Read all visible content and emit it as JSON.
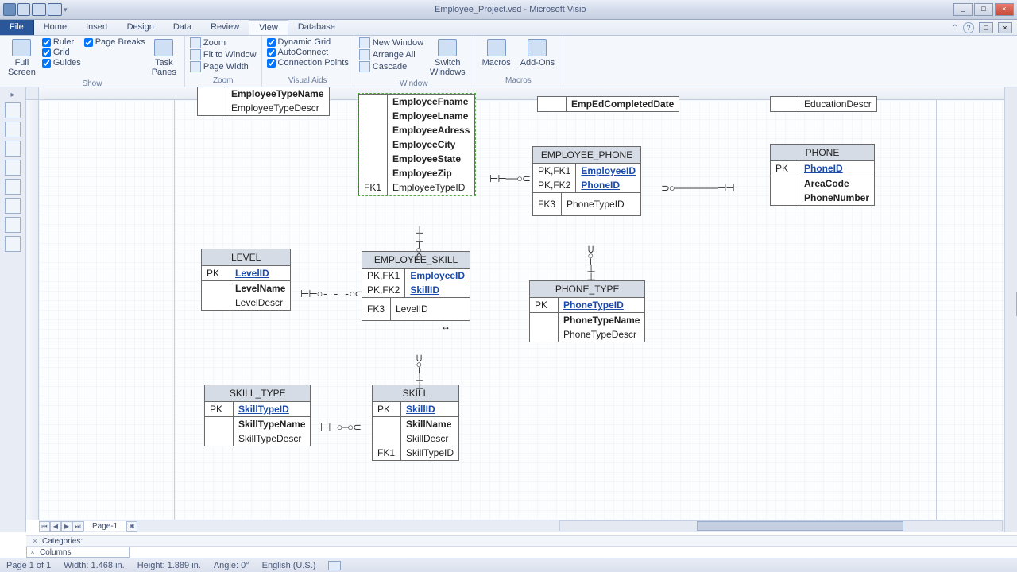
{
  "app": {
    "title": "Employee_Project.vsd - Microsoft Visio"
  },
  "menu": {
    "file": "File",
    "home": "Home",
    "insert": "Insert",
    "design": "Design",
    "data": "Data",
    "review": "Review",
    "view": "View",
    "database": "Database"
  },
  "ribbon": {
    "show": {
      "label": "Show",
      "ruler": "Ruler",
      "grid": "Grid",
      "guides": "Guides",
      "pagebreaks": "Page Breaks",
      "fullscreen": "Full\nScreen",
      "taskpanes": "Task\nPanes"
    },
    "zoom": {
      "label": "Zoom",
      "zoom": "Zoom",
      "fit": "Fit to Window",
      "width": "Page Width"
    },
    "visual": {
      "label": "Visual Aids",
      "dynamic": "Dynamic Grid",
      "auto": "AutoConnect",
      "conn": "Connection Points"
    },
    "window": {
      "label": "Window",
      "neww": "New Window",
      "arrange": "Arrange All",
      "cascade": "Cascade",
      "switch": "Switch\nWindows"
    },
    "macros": {
      "label": "Macros",
      "macros": "Macros",
      "addons": "Add-Ons"
    }
  },
  "entities": {
    "emptype": {
      "rows": [
        "EmployeeTypeName",
        "EmployeeTypeDescr"
      ]
    },
    "employee": {
      "rows": [
        "EmployeeFname",
        "EmployeeLname",
        "EmployeeAdress",
        "EmployeeCity",
        "EmployeeState",
        "EmployeeZip"
      ],
      "fk1": "FK1",
      "fkval": "EmployeeTypeID"
    },
    "emped": {
      "val": "EmpEdCompletedDate"
    },
    "edu": {
      "val": "EducationDescr"
    },
    "empphone": {
      "title": "EMPLOYEE_PHONE",
      "k1": "PK,FK1",
      "k2": "PK,FK2",
      "v1": "EmployeeID",
      "v2": "PhoneID",
      "k3": "FK3",
      "v3": "PhoneTypeID"
    },
    "phone": {
      "title": "PHONE",
      "k": "PK",
      "v": "PhoneID",
      "a1": "AreaCode",
      "a2": "PhoneNumber"
    },
    "phonetype": {
      "title": "PHONE_TYPE",
      "k": "PK",
      "v": "PhoneTypeID",
      "a1": "PhoneTypeName",
      "a2": "PhoneTypeDescr"
    },
    "level": {
      "title": "LEVEL",
      "k": "PK",
      "v": "LevelID",
      "a1": "LevelName",
      "a2": "LevelDescr"
    },
    "empskill": {
      "title": "EMPLOYEE_SKILL",
      "k1": "PK,FK1",
      "k2": "PK,FK2",
      "v1": "EmployeeID",
      "v2": "SkillID",
      "k3": "FK3",
      "v3": "LevelID"
    },
    "skilltype": {
      "title": "SKILL_TYPE",
      "k": "PK",
      "v": "SkillTypeID",
      "a1": "SkillTypeName",
      "a2": "SkillTypeDescr"
    },
    "skill": {
      "title": "SKILL",
      "k": "PK",
      "v": "SkillID",
      "a1": "SkillName",
      "a2": "SkillDescr",
      "fk": "FK1",
      "fv": "SkillTypeID"
    }
  },
  "pagetab": "Page-1",
  "categories": {
    "label": "Categories:",
    "columns": "Columns"
  },
  "status": {
    "page": "Page 1 of 1",
    "width": "Width: 1.468 in.",
    "height": "Height: 1.889 in.",
    "angle": "Angle: 0°",
    "lang": "English (U.S.)"
  }
}
